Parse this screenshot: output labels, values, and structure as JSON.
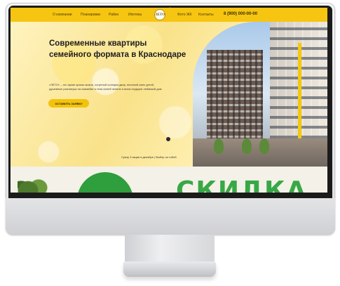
{
  "nav": {
    "items": [
      "О компании",
      "Планировки",
      "Район",
      "Ипотека",
      "Фото ЖК",
      "Контакты"
    ],
    "logo_text": "ЛЕТО",
    "phone": "8 (900) 000-00-00"
  },
  "hero": {
    "headline": "Современные квартиры семейного формата в Краснодаре",
    "subtext": "«ЛЕТО» – это яркие краски жизни, согретый солнцем двор, веселый смех детей, душевные разговоры на скамейке в тени аллей зелени и всем сердцем любимый дом",
    "cta_label": "ОСТАВИТЬ ЗАЯВКУ",
    "promo_text": "Сразу 3 акции в декабре | Выбор за тобой"
  },
  "bottom": {
    "big_word": "СКИДКА"
  },
  "colors": {
    "accent": "#f6c512",
    "green": "#38a846"
  }
}
